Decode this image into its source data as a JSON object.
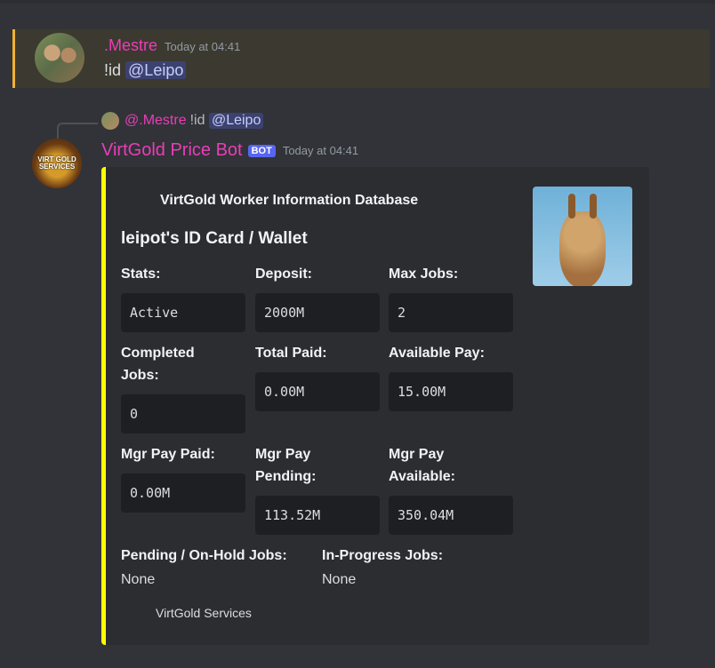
{
  "message1": {
    "author": ".Mestre",
    "timestamp": "Today at 04:41",
    "command": "!id",
    "mention": "@Leipo"
  },
  "message2": {
    "reply": {
      "author": "@.Mestre",
      "command": "!id",
      "mention": "@Leipo"
    },
    "author": "VirtGold Price Bot",
    "badge": "BOT",
    "timestamp": "Today at 04:41",
    "avatar_text": "VIRT GOLD SERVICES",
    "embed": {
      "color": "#ffff00",
      "author": "VirtGold Worker Information Database",
      "title": "leipot's ID Card / Wallet",
      "thumbnail": "giraffe-image",
      "fields": {
        "stats": {
          "name": "Stats:",
          "value": "Active"
        },
        "deposit": {
          "name": "Deposit:",
          "value": "2000M"
        },
        "max_jobs": {
          "name": "Max Jobs:",
          "value": "2"
        },
        "completed_jobs": {
          "name": "Completed Jobs:",
          "value": "0"
        },
        "total_paid": {
          "name": "Total Paid:",
          "value": "0.00M"
        },
        "available_pay": {
          "name": "Available Pay:",
          "value": "15.00M"
        },
        "mgr_pay_paid": {
          "name": "Mgr Pay Paid:",
          "value": "0.00M"
        },
        "mgr_pay_pending": {
          "name": "Mgr Pay Pending:",
          "value": "113.52M"
        },
        "mgr_pay_available": {
          "name": "Mgr Pay Available:",
          "value": "350.04M"
        },
        "pending_jobs": {
          "name": "Pending / On-Hold Jobs:",
          "value": "None"
        },
        "in_progress_jobs": {
          "name": "In-Progress Jobs:",
          "value": "None"
        }
      },
      "footer": "VirtGold Services"
    }
  }
}
